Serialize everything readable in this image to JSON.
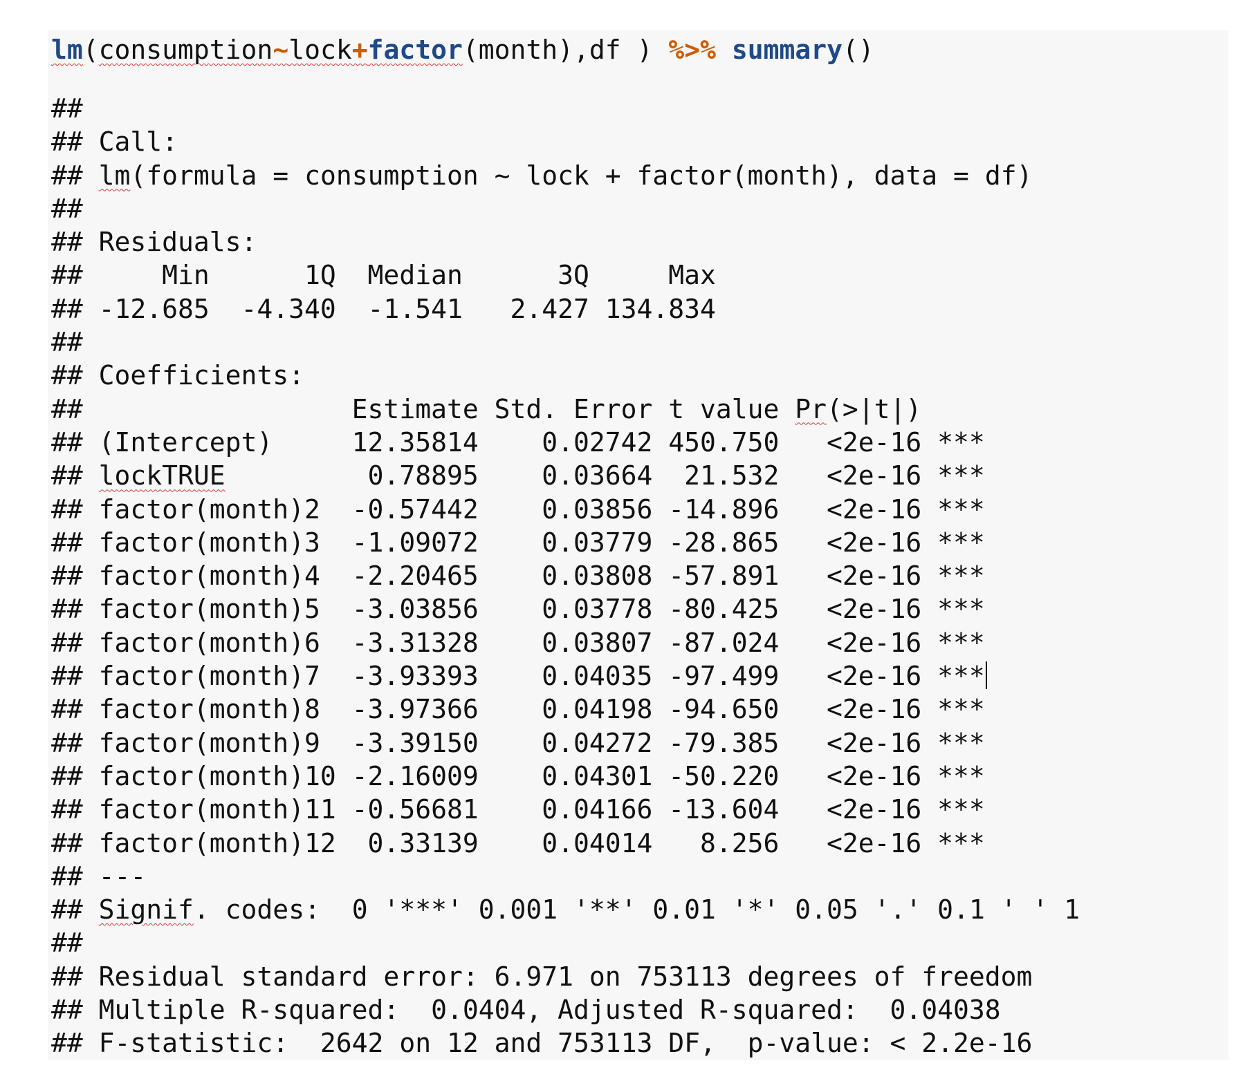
{
  "code": {
    "tokens": {
      "lm": "lm",
      "paren_open": "(",
      "consumption": "consumption",
      "tilde": "~",
      "lock": "lock",
      "plus": "+",
      "factor": "factor",
      "rest": "(month),df ) ",
      "pipe": "%>%",
      "space": " ",
      "summary": "summary",
      "call_parens": "()"
    }
  },
  "output": {
    "prefix": "## ",
    "lines": [
      "##",
      "## Call:",
      "## lm(formula = consumption ~ lock + factor(month), data = df)",
      "##",
      "## Residuals:",
      "##     Min      1Q  Median      3Q     Max ",
      "## -12.685  -4.340  -1.541   2.427 134.834 ",
      "##",
      "## Coefficients:",
      "##                 Estimate Std. Error t value Pr(>|t|)    ",
      "## (Intercept)     12.35814    0.02742 450.750   <2e-16 ***",
      "## lockTRUE          0.78895    0.03664  21.532   <2e-16 ***",
      "## factor(month)2  -0.57442    0.03856 -14.896   <2e-16 ***",
      "## factor(month)3  -1.09072    0.03779 -28.865   <2e-16 ***",
      "## factor(month)4  -2.20465    0.03808 -57.891   <2e-16 ***",
      "## factor(month)5  -3.03856    0.03778 -80.425   <2e-16 ***",
      "## factor(month)6  -3.31328    0.03807 -87.024   <2e-16 ***",
      "## factor(month)7  -3.93393    0.04035 -97.499   <2e-16 ***",
      "## factor(month)8  -3.97366    0.04198 -94.650   <2e-16 ***",
      "## factor(month)9  -3.39150    0.04272 -79.385   <2e-16 ***",
      "## factor(month)10 -2.16009    0.04301 -50.220   <2e-16 ***",
      "## factor(month)11 -0.56681    0.04166 -13.604   <2e-16 ***",
      "## factor(month)12  0.33139    0.04014   8.256   <2e-16 ***",
      "## ---",
      "## Signif. codes:  0 '***' 0.001 '**' 0.01 '*' 0.05 '.' 0.1 ' ' 1",
      "##",
      "## Residual standard error: 6.971 on 753113 degrees of freedom",
      "## Multiple R-squared:  0.0404, Adjusted R-squared:  0.04038 ",
      "## F-statistic:  2642 on 12 and 753113 DF,  p-value: < 2.2e-16"
    ]
  },
  "colors": {
    "background": "#f7f7f7",
    "function": "#204a87",
    "operator": "#ce5c00",
    "text": "#111111",
    "spellcheck": "#d23c3c"
  }
}
